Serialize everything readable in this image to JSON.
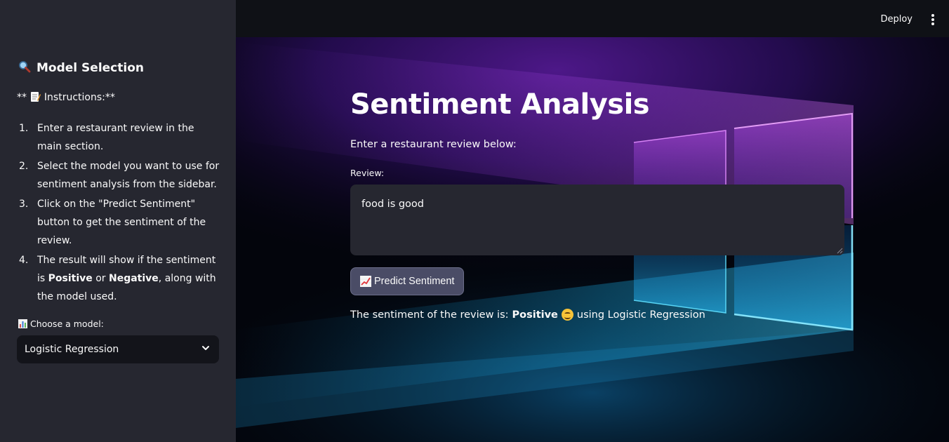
{
  "sidebar": {
    "heading": "Model Selection",
    "heading_icon": "magnifying-glass-icon",
    "instructions_prefix": "** ",
    "instructions_label": "Instructions:**",
    "instructions_icon": "memo-icon",
    "steps": [
      {
        "num": "1.",
        "parts": [
          "Enter a restaurant review in the main section."
        ]
      },
      {
        "num": "2.",
        "parts": [
          "Select the model you want to use for sentiment analysis from the sidebar."
        ]
      },
      {
        "num": "3.",
        "parts": [
          "Click on the \"Predict Sentiment\" button to get the sentiment of the review."
        ]
      },
      {
        "num": "4.",
        "before": "The result will show if the sentiment is ",
        "bold1": "Positive",
        "mid": " or ",
        "bold2": "Negative",
        "after": ", along with the model used."
      }
    ],
    "select_label": "Choose a model:",
    "select_label_icon": "bar-chart-icon",
    "select_value": "Logistic Regression"
  },
  "topbar": {
    "deploy_label": "Deploy",
    "menu_icon": "kebab-menu-icon"
  },
  "main": {
    "title": "Sentiment Analysis",
    "subtitle": "Enter a restaurant review below:",
    "review_label": "Review:",
    "review_value": "food is good",
    "predict_button": "Predict Sentiment",
    "predict_icon": "chart-increasing-icon",
    "result_prefix": "The sentiment of the review is:",
    "result_value": "Positive",
    "result_icon": "smiling-face-icon",
    "result_suffix": "using Logistic Regression"
  },
  "colors": {
    "sidebar_bg": "#262730",
    "main_bg": "#0e1117",
    "input_bg": "#262730",
    "button_bg": "#4a4c66"
  }
}
